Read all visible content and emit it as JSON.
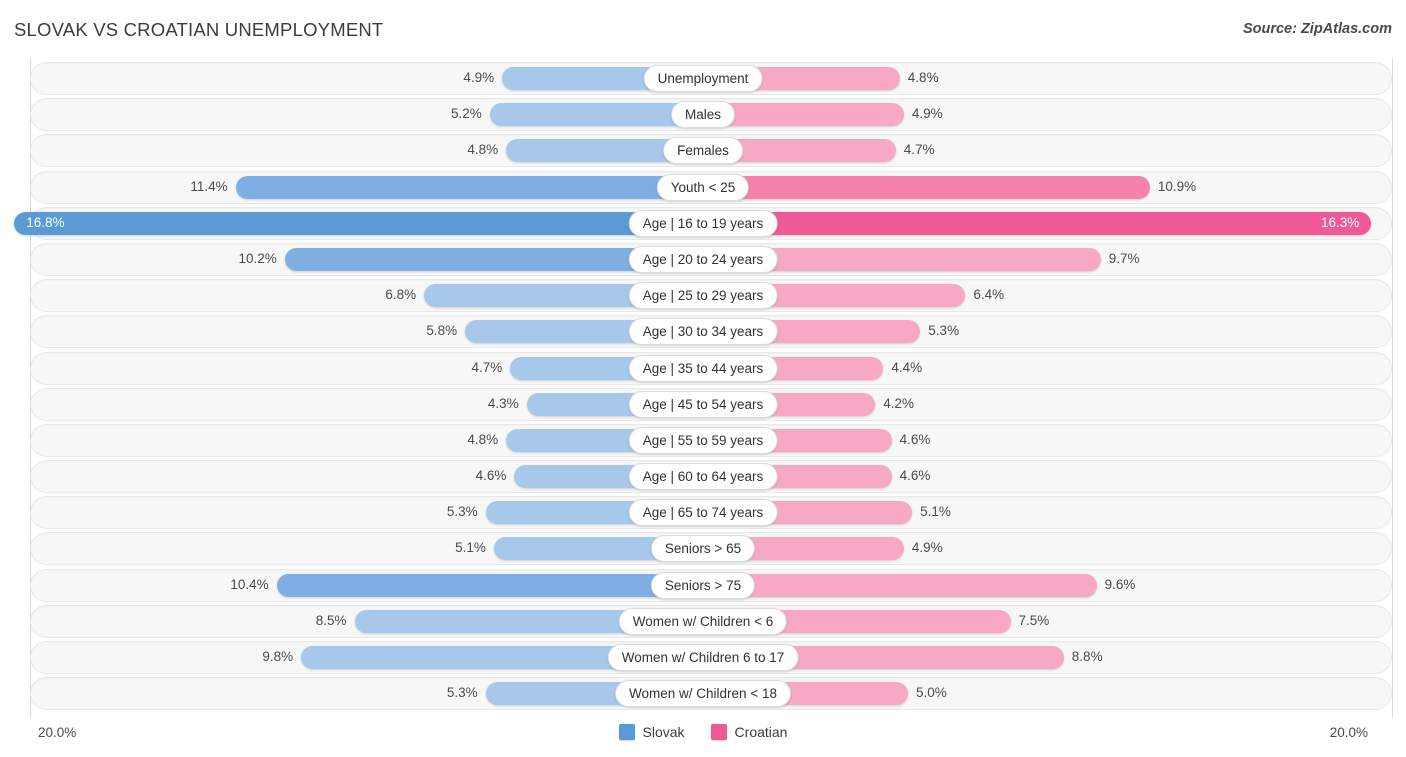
{
  "header": {
    "title": "SLOVAK VS CROATIAN UNEMPLOYMENT",
    "source": "Source: ZipAtlas.com"
  },
  "axis": {
    "left_cap": "20.0%",
    "right_cap": "20.0%",
    "max": 20.0
  },
  "legend": {
    "items": [
      {
        "label": "Slovak",
        "color": "#5b9bd5"
      },
      {
        "label": "Croatian",
        "color": "#ef5a96"
      }
    ]
  },
  "colors": {
    "left_light": "#a7c8ea",
    "left_mid": "#7eaee2",
    "left_strong": "#5b9bd5",
    "right_light": "#f7a8c4",
    "right_mid": "#f582ab",
    "right_strong": "#ef5a96",
    "track": "#f7f7f7",
    "track_border": "#e9e9e9"
  },
  "chart_data": {
    "type": "bar",
    "subtype": "diverging-bar",
    "title": "SLOVAK VS CROATIAN UNEMPLOYMENT",
    "xlabel": "",
    "ylabel": "",
    "xlim": [
      20.0,
      20.0
    ],
    "grid": false,
    "legend_position": "bottom-center",
    "value_suffix": "%",
    "categories": [
      "Unemployment",
      "Males",
      "Females",
      "Youth < 25",
      "Age | 16 to 19 years",
      "Age | 20 to 24 years",
      "Age | 25 to 29 years",
      "Age | 30 to 34 years",
      "Age | 35 to 44 years",
      "Age | 45 to 54 years",
      "Age | 55 to 59 years",
      "Age | 60 to 64 years",
      "Age | 65 to 74 years",
      "Seniors > 65",
      "Seniors > 75",
      "Women w/ Children < 6",
      "Women w/ Children 6 to 17",
      "Women w/ Children < 18"
    ],
    "series": [
      {
        "name": "Slovak",
        "side": "left",
        "color": "#5b9bd5",
        "values": [
          4.9,
          5.2,
          4.8,
          11.4,
          16.8,
          10.2,
          6.8,
          5.8,
          4.7,
          4.3,
          4.8,
          4.6,
          5.3,
          5.1,
          10.4,
          8.5,
          9.8,
          5.3
        ],
        "labels": [
          "4.9%",
          "5.2%",
          "4.8%",
          "11.4%",
          "16.8%",
          "10.2%",
          "6.8%",
          "5.8%",
          "4.7%",
          "4.3%",
          "4.8%",
          "4.6%",
          "5.3%",
          "5.1%",
          "10.4%",
          "8.5%",
          "9.8%",
          "5.3%"
        ]
      },
      {
        "name": "Croatian",
        "side": "right",
        "color": "#ef5a96",
        "values": [
          4.8,
          4.9,
          4.7,
          10.9,
          16.3,
          9.7,
          6.4,
          5.3,
          4.4,
          4.2,
          4.6,
          4.6,
          5.1,
          4.9,
          9.6,
          7.5,
          8.8,
          5.0
        ],
        "labels": [
          "4.8%",
          "4.9%",
          "4.7%",
          "10.9%",
          "16.3%",
          "9.7%",
          "6.4%",
          "5.3%",
          "4.4%",
          "4.2%",
          "4.6%",
          "4.6%",
          "5.1%",
          "4.9%",
          "9.6%",
          "7.5%",
          "8.8%",
          "5.0%"
        ]
      }
    ]
  }
}
